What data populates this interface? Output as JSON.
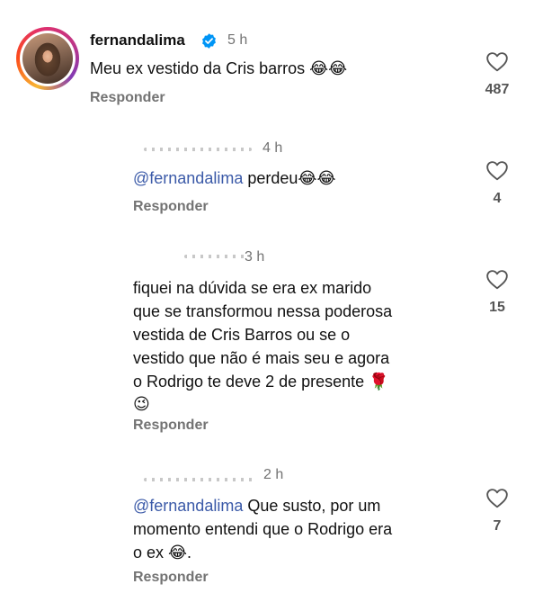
{
  "comments": [
    {
      "username": "fernandalima",
      "time": "5 h",
      "text": "Meu ex vestido da Cris barros",
      "emoji": "😂😂",
      "reply_label": "Responder",
      "likes": "487"
    },
    {
      "time": "4 h",
      "mention": "@fernandalima",
      "text": " perdeu",
      "emoji": "😂😂",
      "reply_label": "Responder",
      "likes": "4"
    },
    {
      "time": "3 h",
      "lines": [
        "fiquei na dúvida se era ex marido",
        "que se transformou nessa poderosa",
        "vestida de Cris Barros ou se o",
        "vestido que não é mais seu e agora",
        "o Rodrigo te deve 2 de presente 🌹",
        "😉"
      ],
      "reply_label": "Responder",
      "likes": "15"
    },
    {
      "time": "2 h",
      "mention": "@fernandalima",
      "lines": [
        " Que susto, por um",
        "momento entendi que o Rodrigo era",
        "o ex 😂."
      ],
      "reply_label": "Responder",
      "likes": "7"
    }
  ],
  "colors": {
    "mention": "#3b5aa8",
    "verified_badge": "#0095f6",
    "secondary_text": "#737373"
  },
  "icons": {
    "like": "heart-outline-icon",
    "verified": "verified-badge-icon"
  }
}
